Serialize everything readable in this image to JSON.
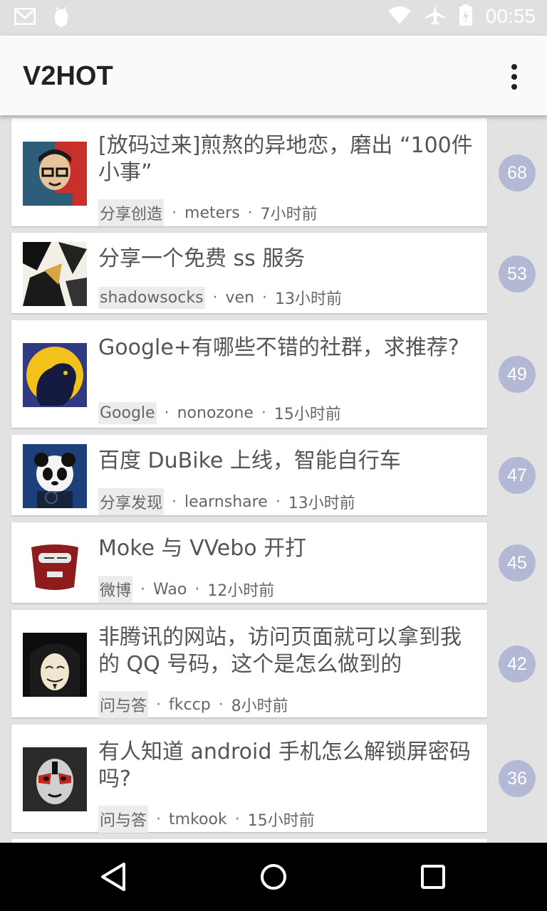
{
  "status_bar": {
    "time": "00:55",
    "icons_left": [
      "gmail-icon",
      "android-debug-icon"
    ],
    "icons_right": [
      "wifi-icon",
      "airplane-icon",
      "battery-icon"
    ]
  },
  "app_bar": {
    "title": "V2HOT",
    "menu_icon": "overflow-menu-icon"
  },
  "topics": [
    {
      "title": "[放码过来]煎熬的异地恋，磨出 “100件小事”",
      "node": "分享创造",
      "author": "meters",
      "time": "7小时前",
      "replies": "68"
    },
    {
      "title": "分享一个免费 ss 服务",
      "node": "shadowsocks",
      "author": "ven",
      "time": "13小时前",
      "replies": "53"
    },
    {
      "title": "Google+有哪些不错的社群，求推荐?",
      "node": "Google",
      "author": "nonozone",
      "time": "15小时前",
      "replies": "49"
    },
    {
      "title": "百度 DuBike 上线，智能自行车",
      "node": "分享发现",
      "author": "learnshare",
      "time": "13小时前",
      "replies": "47"
    },
    {
      "title": "Moke 与 VVebo 开打",
      "node": "微博",
      "author": "Wao",
      "time": "12小时前",
      "replies": "45"
    },
    {
      "title": "非腾讯的网站，访问页面就可以拿到我的 QQ 号码，这个是怎么做到的",
      "node": "问与答",
      "author": "fkccp",
      "time": "8小时前",
      "replies": "42"
    },
    {
      "title": "有人知道 android 手机怎么解锁屏密码吗?",
      "node": "问与答",
      "author": "tmkook",
      "time": "15小时前",
      "replies": "36"
    }
  ],
  "separator": "·",
  "nav_bar": {
    "icons": [
      "back-icon",
      "home-icon",
      "recents-icon"
    ]
  },
  "colors": {
    "count_badge": "#b3b8d4",
    "app_bar": "#fafafa",
    "background": "#e2e2e2"
  }
}
